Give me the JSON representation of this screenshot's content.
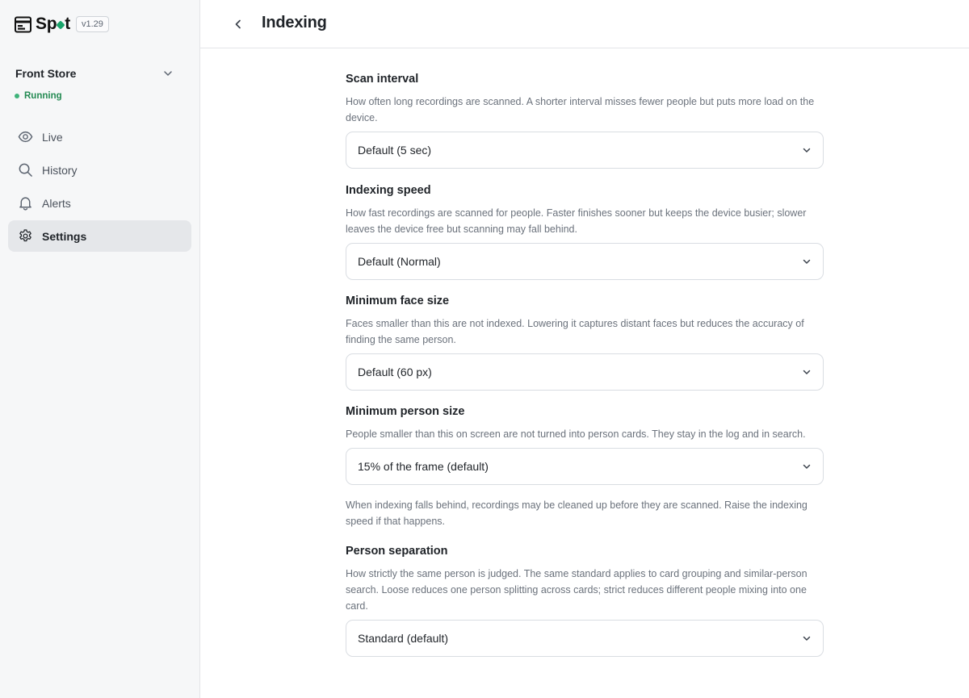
{
  "app": {
    "name_pre": "Sp",
    "name_post": "t",
    "version": "v1.29"
  },
  "store": {
    "name": "Front Store",
    "status": "Running"
  },
  "nav": [
    {
      "label": "Live",
      "icon": "eye-icon"
    },
    {
      "label": "History",
      "icon": "search-icon"
    },
    {
      "label": "Alerts",
      "icon": "bell-icon"
    },
    {
      "label": "Settings",
      "icon": "gear-icon",
      "active": true
    }
  ],
  "header": {
    "title": "Indexing"
  },
  "settings": {
    "scan_interval": {
      "title": "Scan interval",
      "description": "How often long recordings are scanned. A shorter interval misses fewer people but puts more load on the device.",
      "value": "Default (5 sec)"
    },
    "indexing_speed": {
      "title": "Indexing speed",
      "description": "How fast recordings are scanned for people. Faster finishes sooner but keeps the device busier; slower leaves the device free but scanning may fall behind.",
      "value": "Default (Normal)"
    },
    "min_face_size": {
      "title": "Minimum face size",
      "description": "Faces smaller than this are not indexed. Lowering it captures distant faces but reduces the accuracy of finding the same person.",
      "value": "Default (60 px)"
    },
    "min_person_size": {
      "title": "Minimum person size",
      "description": "People smaller than this on screen are not turned into person cards. They stay in the log and in search.",
      "value": "15% of the frame (default)"
    },
    "note": "When indexing falls behind, recordings may be cleaned up before they are scanned. Raise the indexing speed if that happens.",
    "person_separation": {
      "title": "Person separation",
      "description": "How strictly the same person is judged. The same standard applies to card grouping and similar-person search. Loose reduces one person splitting across cards; strict reduces different people mixing into one card.",
      "value": "Standard (default)"
    }
  },
  "colors": {
    "accent": "#19a46b",
    "status": "#238a52",
    "active_nav_bg": "#e5e7ea"
  }
}
